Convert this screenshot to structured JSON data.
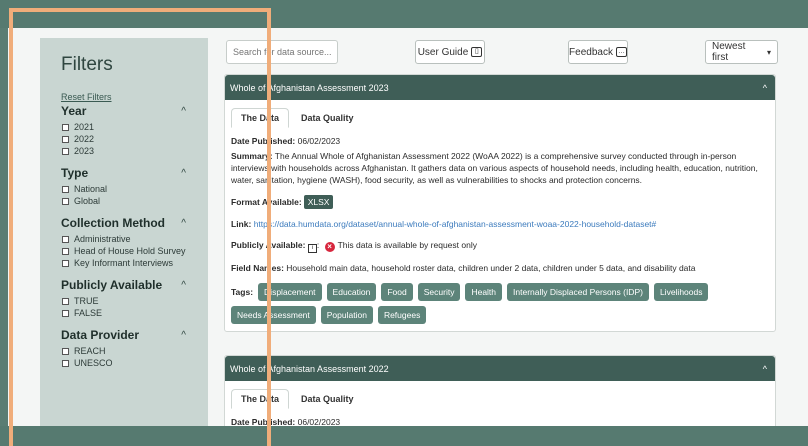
{
  "sidebar": {
    "title": "Filters",
    "reset": "Reset Filters",
    "groups": [
      {
        "title": "Year",
        "items": [
          "2021",
          "2022",
          "2023"
        ]
      },
      {
        "title": "Type",
        "items": [
          "National",
          "Global"
        ]
      },
      {
        "title": "Collection Method",
        "items": [
          "Administrative",
          "Head of House Hold Survey",
          "Key Informant Interviews"
        ]
      },
      {
        "title": "Publicly Available",
        "items": [
          "TRUE",
          "FALSE"
        ]
      },
      {
        "title": "Data Provider",
        "items": [
          "REACH",
          "UNESCO"
        ]
      }
    ]
  },
  "toolbar": {
    "search_placeholder": "Search for data source...",
    "user_guide": "User Guide",
    "feedback": "Feedback",
    "sort": "Newest first"
  },
  "cards": [
    {
      "title": "Whole of Afghanistan Assessment 2023",
      "tab_data": "The Data",
      "tab_quality": "Data Quality",
      "date_label": "Date Published:",
      "date": "06/02/2023",
      "summary_label": "Summary:",
      "summary": "The Annual Whole of Afghanistan Assessment 2022 (WoAA 2022) is a comprehensive survey conducted through in-person interviews with households across Afghanistan. It gathers data on various aspects of household needs, including health, education, nutrition, water, sanitation, hygiene (WASH), food security, as well as vulnerabilities to shocks and protection concerns.",
      "format_label": "Format Available:",
      "format": "XLSX",
      "link_label": "Link:",
      "link": "https://data.humdata.org/dataset/annual-whole-of-afghanistan-assessment-woaa-2022-household-dataset#",
      "public_label": "Publicly Available:",
      "public_text": "This data is available by request only",
      "fields_label": "Field Names:",
      "fields": "Household main data, household roster data, children under 2 data, children under 5 data, and disability data",
      "tags_label": "Tags:",
      "tags": [
        "Displacement",
        "Education",
        "Food",
        "Security",
        "Health",
        "Internally Displaced Persons (IDP)",
        "Livelihoods",
        "Needs Assessment",
        "Population",
        "Refugees"
      ]
    },
    {
      "title": "Whole of Afghanistan Assessment 2022",
      "tab_data": "The Data",
      "tab_quality": "Data Quality",
      "date_label": "Date Published:",
      "date": "06/02/2023"
    }
  ]
}
